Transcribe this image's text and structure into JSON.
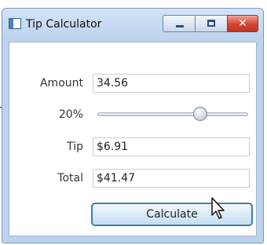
{
  "window": {
    "title": "Tip Calculator"
  },
  "form": {
    "amount_label": "Amount",
    "amount_value": "34.56",
    "percent_label": "20%",
    "slider_value": 0.7,
    "tip_label": "Tip",
    "tip_value": "$6.91",
    "total_label": "Total",
    "total_value": "$41.47",
    "calculate_label": "Calculate"
  },
  "controls": {
    "minimize_icon": "minimize-icon",
    "maximize_icon": "maximize-icon",
    "close_icon": "close-icon"
  }
}
